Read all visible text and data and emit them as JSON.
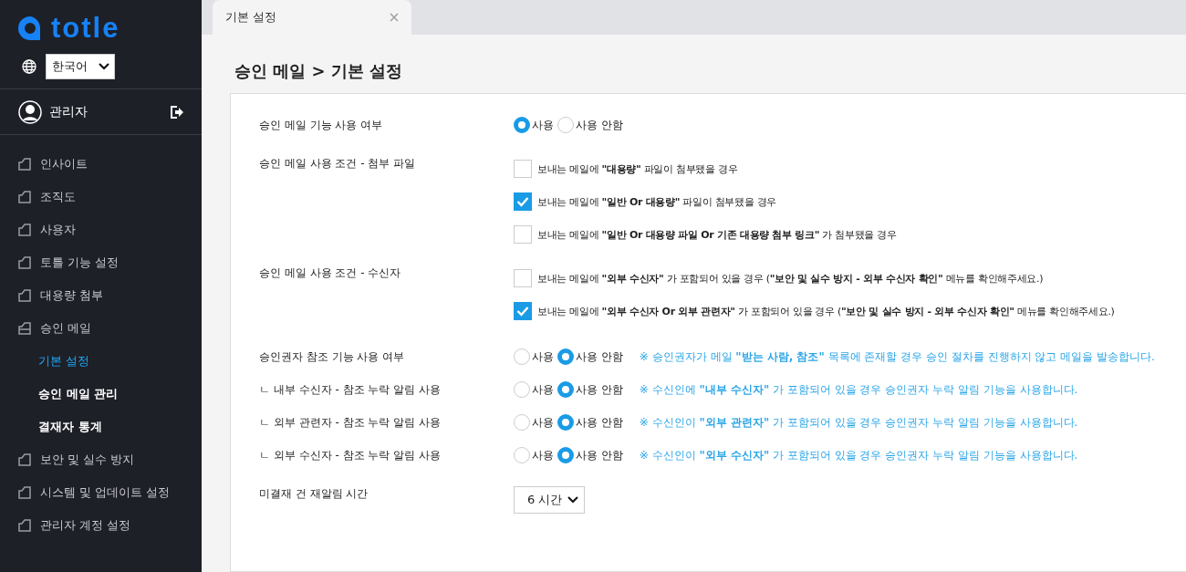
{
  "sidebar": {
    "logo": "totle",
    "language": "한국어",
    "user": "관리자",
    "nav": [
      {
        "label": "인사이트",
        "expanded": false
      },
      {
        "label": "조직도",
        "expanded": false
      },
      {
        "label": "사용자",
        "expanded": false
      },
      {
        "label": "토틀 기능 설정",
        "expanded": false
      },
      {
        "label": "대용량 첨부",
        "expanded": false
      },
      {
        "label": "승인 메일",
        "expanded": true,
        "children": [
          {
            "label": "기본 설정",
            "selected": true
          },
          {
            "label": "승인 메일 관리",
            "selected": false
          },
          {
            "label": "결재자 통계",
            "selected": false
          }
        ]
      },
      {
        "label": "보안 및 실수 방지",
        "expanded": false
      },
      {
        "label": "시스템 및 업데이트 설정",
        "expanded": false
      },
      {
        "label": "관리자 계정 설정",
        "expanded": false
      }
    ]
  },
  "tabs": [
    {
      "label": "기본 설정",
      "selected": true
    }
  ],
  "page_title": "승인 메일 > 기본 설정",
  "settings": [
    {
      "kind": "radio",
      "label": "승인 메일 기능 사용 여부",
      "options": [
        {
          "label": "사용",
          "selected": true
        },
        {
          "label": "사용 안함",
          "selected": false
        }
      ]
    },
    {
      "kind": "checklist",
      "label": "승인 메일 사용 조건 - 첨부 파일",
      "items": [
        {
          "text": "보내는 메일에 **\"대용량\"** 파일이 첨부됐을 경우",
          "checked": false
        },
        {
          "text": "보내는 메일에 **\"일반 Or 대용량\"** 파일이 첨부됐을 경우",
          "checked": true
        },
        {
          "text": "보내는 메일에 **\"일반 Or 대용량 파일 Or 기존 대용량 첨부 링크\"** 가 첨부됐을 경우",
          "checked": false
        }
      ]
    },
    {
      "kind": "checklist",
      "label": "승인 메일 사용 조건 - 수신자",
      "items": [
        {
          "text": "보내는 메일에 **\"외부 수신자\"** 가 포함되어 있을 경우 (**\"보안 및 실수 방지 - 외부 수신자 확인\"** 메뉴를 확인해주세요.)",
          "checked": false
        },
        {
          "text": "보내는 메일에 **\"외부 수신자 Or 외부 관련자\"** 가 포함되어 있을 경우 (**\"보안 및 실수 방지 - 외부 수신자 확인\"** 메뉴를 확인해주세요.)",
          "checked": true
        }
      ]
    },
    {
      "kind": "radio",
      "label": "승인권자 참조 기능 사용 여부",
      "options": [
        {
          "label": "사용",
          "selected": false
        },
        {
          "label": "사용 안함",
          "selected": true
        }
      ],
      "note": "※ 승인권자가 메일 **\"받는 사람, 참조\"** 목록에 존재할 경우 승인 절차를 진행하지 않고 메일을 발송합니다."
    },
    {
      "kind": "radio",
      "label": "ㄴ 내부 수신자 - 참조 누락 알림 사용",
      "options": [
        {
          "label": "사용",
          "selected": false
        },
        {
          "label": "사용 안함",
          "selected": true
        }
      ],
      "note": "※ 수신인에 **\"내부 수신자\"** 가 포함되어 있을 경우 승인권자 누락 알림 기능을 사용합니다."
    },
    {
      "kind": "radio",
      "label": "ㄴ 외부 관련자 - 참조 누락 알림 사용",
      "options": [
        {
          "label": "사용",
          "selected": false
        },
        {
          "label": "사용 안함",
          "selected": true
        }
      ],
      "note": "※ 수신인이 **\"외부 관련자\"** 가 포함되어 있을 경우 승인권자 누락 알림 기능을 사용합니다."
    },
    {
      "kind": "radio",
      "label": "ㄴ 외부 수신자 - 참조 누락 알림 사용",
      "options": [
        {
          "label": "사용",
          "selected": false
        },
        {
          "label": "사용 안함",
          "selected": true
        }
      ],
      "note": "※ 수신인이 **\"외부 수신자\"** 가 포함되어 있을 경우 승인권자 누락 알림 기능을 사용합니다."
    },
    {
      "kind": "select",
      "label": "미결재 건 재알림 시간",
      "value": "6 시간"
    }
  ]
}
